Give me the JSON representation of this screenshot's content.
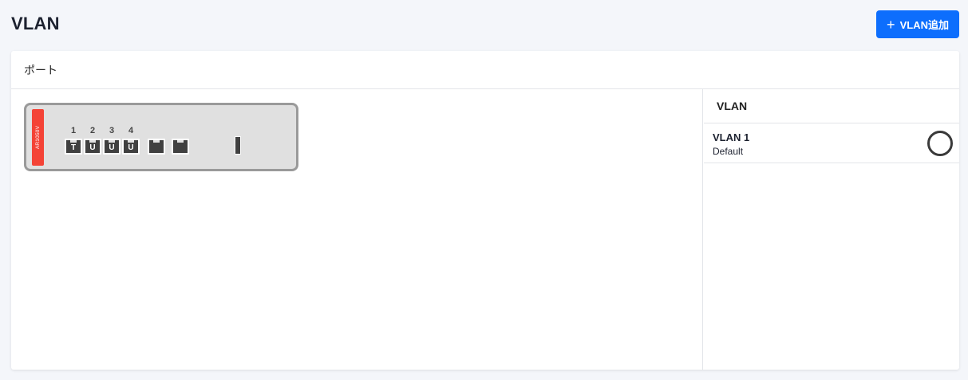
{
  "page": {
    "title": "VLAN"
  },
  "toolbar": {
    "add_label": "VLAN追加",
    "add_icon": "plus-icon"
  },
  "port_panel": {
    "title": "ポート"
  },
  "device": {
    "model": "AR1050V",
    "brand_color": "#f44336",
    "ports": [
      {
        "number": "1",
        "tag": "T"
      },
      {
        "number": "2",
        "tag": "U"
      },
      {
        "number": "3",
        "tag": "U"
      },
      {
        "number": "4",
        "tag": "U"
      },
      {
        "number": "",
        "tag": ""
      },
      {
        "number": "",
        "tag": ""
      }
    ]
  },
  "vlan_list": {
    "title": "VLAN",
    "items": [
      {
        "name": "VLAN 1",
        "description": "Default"
      }
    ]
  },
  "colors": {
    "accent": "#0d6efd",
    "background": "#f4f6fa"
  }
}
